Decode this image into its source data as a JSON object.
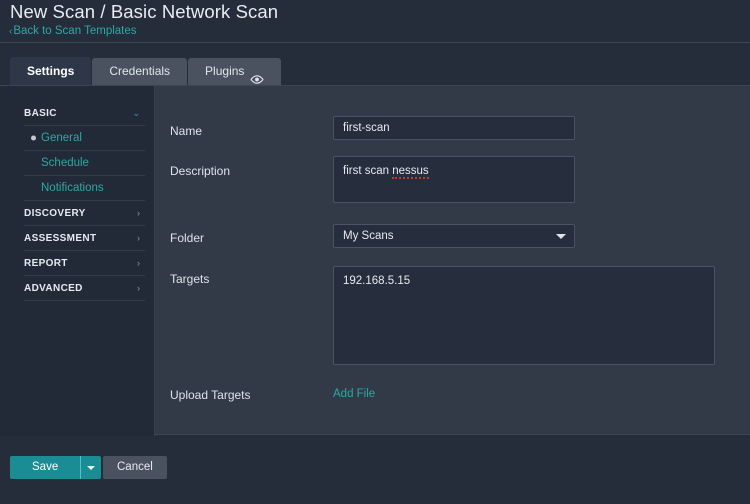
{
  "header": {
    "title": "New Scan / Basic Network Scan",
    "back_link": "Back to Scan Templates",
    "back_chevron": "‹"
  },
  "tabs": [
    {
      "label": "Settings",
      "active": true,
      "icon": ""
    },
    {
      "label": "Credentials",
      "active": false,
      "icon": ""
    },
    {
      "label": "Plugins",
      "active": false,
      "icon": "eye-icon"
    }
  ],
  "sidebar": {
    "groups": [
      {
        "label": "BASIC",
        "chevron": "⌄",
        "expanded": true,
        "items": [
          {
            "label": "General",
            "selected": true
          },
          {
            "label": "Schedule",
            "selected": false
          },
          {
            "label": "Notifications",
            "selected": false
          }
        ]
      },
      {
        "label": "DISCOVERY",
        "chevron": "›",
        "expanded": false,
        "items": []
      },
      {
        "label": "ASSESSMENT",
        "chevron": "›",
        "expanded": false,
        "items": []
      },
      {
        "label": "REPORT",
        "chevron": "›",
        "expanded": false,
        "items": []
      },
      {
        "label": "ADVANCED",
        "chevron": "›",
        "expanded": false,
        "items": []
      }
    ]
  },
  "form": {
    "name": {
      "label": "Name",
      "value": "first-scan",
      "placeholder": ""
    },
    "description": {
      "label": "Description",
      "value_prefix": "first scan ",
      "value_misspelled": "nessus",
      "placeholder": ""
    },
    "folder": {
      "label": "Folder",
      "value": "My Scans"
    },
    "targets": {
      "label": "Targets",
      "value": "192.168.5.15",
      "placeholder": ""
    },
    "upload_targets": {
      "label": "Upload Targets",
      "link": "Add File"
    }
  },
  "footer": {
    "save_label": "Save",
    "cancel_label": "Cancel"
  },
  "colors": {
    "accent_teal": "#2ea8a4",
    "save_button": "#1a8c93",
    "panel_bg": "#323a48",
    "sidebar_bg": "#222a38",
    "page_bg": "#252c3a",
    "spellcheck_red": "#c0392b"
  }
}
